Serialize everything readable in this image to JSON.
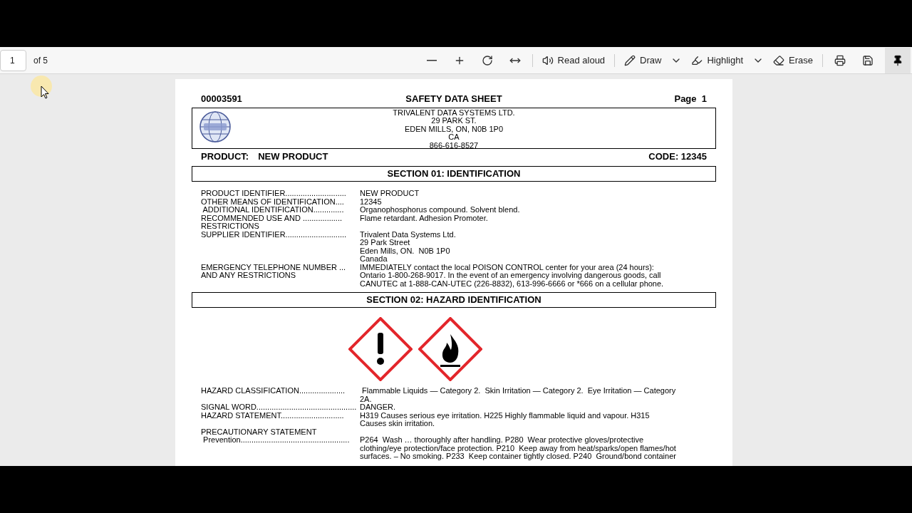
{
  "toolbar": {
    "page_number": "1",
    "page_count": "of 5",
    "buttons": [
      {
        "label": "Read aloud",
        "kind": "read"
      },
      {
        "label": "Draw",
        "kind": "draw"
      },
      {
        "label": "Highlight",
        "kind": "highlight"
      },
      {
        "label": "Erase",
        "kind": "erase"
      }
    ]
  },
  "document": {
    "doc_number": "00003591",
    "title": "SAFETY DATA SHEET",
    "page_label": "Page  1",
    "company_lines": [
      "TRIVALENT DATA SYSTEMS LTD.",
      "29 PARK ST.",
      "EDEN MILLS, ON, N0B 1P0",
      "CA",
      "866-616-8527"
    ],
    "product_label": "PRODUCT:",
    "product_name": "NEW PRODUCT",
    "code": "CODE: 12345",
    "sections": [
      {
        "heading": "SECTION 01: IDENTIFICATION",
        "rows": [
          {
            "label_lines": [
              "PRODUCT IDENTIFIER............................"
            ],
            "value_lines": [
              "NEW PRODUCT"
            ]
          },
          {
            "label_lines": [
              "OTHER MEANS OF IDENTIFICATION...."
            ],
            "value_lines": [
              "12345"
            ]
          },
          {
            "label_lines": [
              " ADDITIONAL IDENTIFICATION.............."
            ],
            "value_lines": [
              "Organophosphorus compound. Solvent blend."
            ]
          },
          {
            "label_lines": [
              "RECOMMENDED USE AND ..................",
              "RESTRICTIONS"
            ],
            "value_lines": [
              "Flame retardant. Adhesion Promoter."
            ]
          },
          {
            "label_lines": [
              "SUPPLIER IDENTIFIER............................"
            ],
            "value_lines": [
              "Trivalent Data Systems Ltd.",
              "29 Park Street",
              "Eden Mills, ON.  N0B 1P0",
              "Canada"
            ]
          },
          {
            "label_lines": [
              "EMERGENCY TELEPHONE NUMBER ...",
              "AND ANY RESTRICTIONS"
            ],
            "value_lines": [
              "IMMEDIATELY contact the local POISON CONTROL center for your area (24 hours):",
              "Ontario 1-800-268-9017. In the event of an emergency involving dangerous goods, call",
              "CANUTEC at 1-888-CAN-UTEC (226-8832), 613-996-6666 or *666 on a cellular phone."
            ]
          }
        ]
      },
      {
        "heading": "SECTION 02: HAZARD IDENTIFICATION",
        "pictograms": [
          {
            "kind": "exclamation"
          },
          {
            "kind": "flame"
          }
        ],
        "rows": [
          {
            "label_lines": [
              "HAZARD CLASSIFICATION....................."
            ],
            "value_lines": [
              " Flammable Liquids — Category 2.  Skin Irritation — Category 2.  Eye Irritation — Category",
              "2A."
            ]
          },
          {
            "label_lines": [
              "SIGNAL WORD.............................................."
            ],
            "value_lines": [
              "DANGER."
            ]
          },
          {
            "label_lines": [
              "HAZARD STATEMENT............................."
            ],
            "value_lines": [
              "H319 Causes serious eye irritation. H225 Highly flammable liquid and vapour. H315",
              "Causes skin irritation."
            ]
          },
          {
            "label_lines": [
              "PRECAUTIONARY STATEMENT"
            ]
          },
          {
            "label_lines": [
              " Prevention.................................................."
            ],
            "value_lines": [
              "P264  Wash … thoroughly after handling. P280  Wear protective gloves/protective",
              "clothing/eye protection/face protection. P210  Keep away from heat/sparks/open flames/hot",
              "surfaces. – No smoking. P233  Keep container tightly closed. P240  Ground/bond container"
            ]
          }
        ]
      }
    ]
  }
}
